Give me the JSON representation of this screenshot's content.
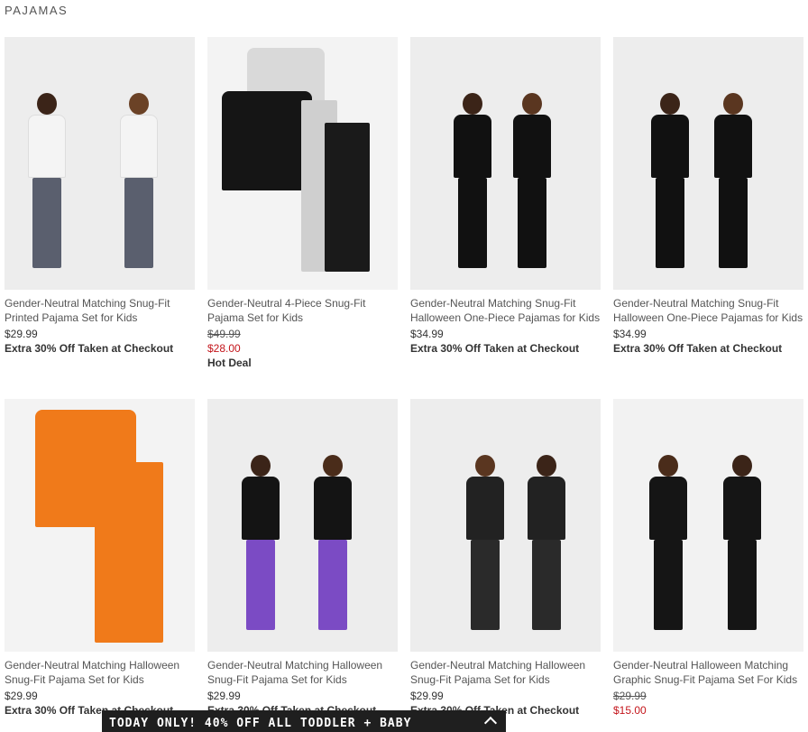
{
  "section_title": "PAJAMAS",
  "products": [
    {
      "name": "Gender-Neutral Matching Snug-Fit Printed Pajama Set for Kids",
      "price": "$29.99",
      "promo": "Extra 30% Off Taken at Checkout"
    },
    {
      "name": "Gender-Neutral 4-Piece Snug-Fit Pajama Set for Kids",
      "original_price": "$49.99",
      "sale_price": "$28.00",
      "promo": "Hot Deal"
    },
    {
      "name": "Gender-Neutral Matching Snug-Fit Halloween One-Piece Pajamas for Kids",
      "price": "$34.99",
      "promo": "Extra 30% Off Taken at Checkout"
    },
    {
      "name": "Gender-Neutral Matching Snug-Fit Halloween One-Piece Pajamas for Kids",
      "price": "$34.99",
      "promo": "Extra 30% Off Taken at Checkout"
    },
    {
      "name": "Gender-Neutral Matching Halloween Snug-Fit Pajama Set for Kids",
      "price": "$29.99",
      "promo": "Extra 30% Off Taken at Checkout"
    },
    {
      "name": "Gender-Neutral Matching Halloween Snug-Fit Pajama Set for Kids",
      "price": "$29.99",
      "promo": "Extra 30% Off Taken at Checkout"
    },
    {
      "name": "Gender-Neutral Matching Halloween Snug-Fit Pajama Set for Kids",
      "price": "$29.99",
      "promo": "Extra 30% Off Taken at Checkout"
    },
    {
      "name": "Gender-Neutral Halloween Matching Graphic Snug-Fit Pajama Set For Kids",
      "original_price": "$29.99",
      "sale_price": "$15.00"
    }
  ],
  "banner": {
    "text": "TODAY ONLY! 40% OFF ALL TODDLER + BABY",
    "icon": "chevron-up-icon"
  },
  "colors": {
    "sale": "#c4161c",
    "banner_bg": "#1f1f1f"
  }
}
